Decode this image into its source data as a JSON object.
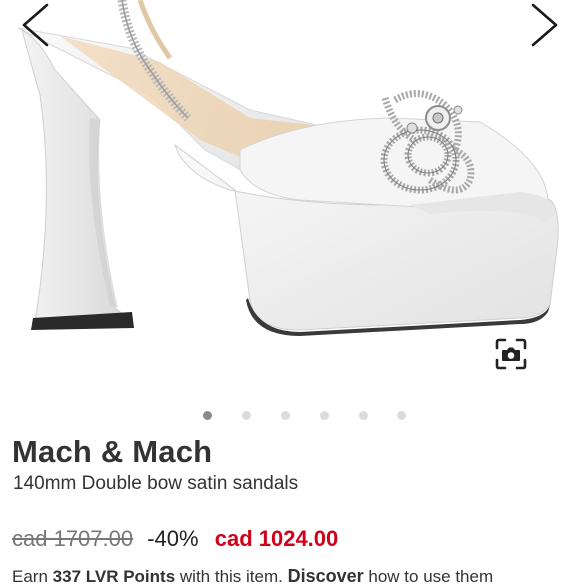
{
  "product": {
    "brand": "Mach & Mach",
    "name": "140mm Double bow satin sandals",
    "old_price": "cad 1707.00",
    "discount": "-40%",
    "new_price": "cad 1024.00"
  },
  "gallery": {
    "image_count": 6,
    "active_index": 0,
    "icons": {
      "prev": "chevron-left-icon",
      "next": "chevron-right-icon",
      "visual_search": "camera-scan-icon"
    }
  },
  "loyalty": {
    "earn_prefix": "Earn",
    "points": "337 LVR Points",
    "middle_text": "with this item.",
    "discover_label": "Discover",
    "suffix": "how to use them"
  },
  "colors": {
    "sale_price": "#d0021b",
    "active_dot": "#8a8a8a",
    "inactive_dot": "#dcdcdc"
  }
}
